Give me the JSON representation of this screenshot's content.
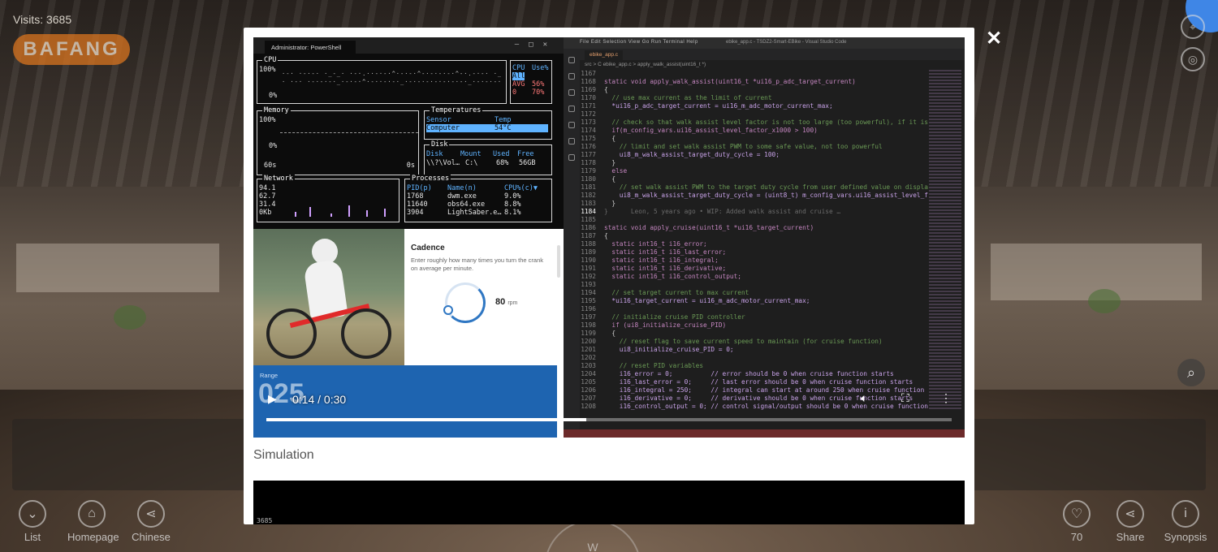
{
  "visits": {
    "label": "Visits:",
    "count": "3685"
  },
  "brand": "BAFANG",
  "bottom_nav": {
    "list": "List",
    "homepage": "Homepage",
    "chinese": "Chinese",
    "likes": "70",
    "share": "Share",
    "synopsis": "Synopsis"
  },
  "compass": "W",
  "modal": {
    "close": "✕",
    "caption": "Simulation",
    "video": {
      "current_time": "0:14",
      "separator": "/",
      "duration": "0:30",
      "progress": 0.467
    }
  },
  "terminal": {
    "tab": "Administrator: PowerShell",
    "cpu": {
      "title": "CPU",
      "y_top": "100%",
      "y_bottom": "0%",
      "hdr_cpu": "CPU",
      "hdr_use": "Use%",
      "all": "All",
      "avg": "AVG",
      "avg_val": "56%",
      "core": "0",
      "core_val": "70%"
    },
    "memory": {
      "title": "Memory",
      "y_top": "100%",
      "y_bottom": "0%",
      "x_left": "60s",
      "x_right": "0s"
    },
    "temps": {
      "title": "Temperatures",
      "h_sensor": "Sensor",
      "h_temp": "Temp",
      "sensor": "Computer",
      "temp": "54°C"
    },
    "disk": {
      "title": "Disk",
      "h_disk": "Disk",
      "h_mount": "Mount",
      "h_used": "Used",
      "h_free": "Free",
      "disk": "\\\\?\\Vol…",
      "mount": "C:\\",
      "used": "68%",
      "free": "56GB"
    },
    "network": {
      "title": "Network",
      "v1": "94.1",
      "v2": "62.7",
      "v3": "31.4",
      "v4": "0Kb"
    },
    "processes": {
      "title": "Processes",
      "h_pid": "PID(p)",
      "h_name": "Name(n)",
      "h_cpu": "CPU%(c)▼",
      "rows": [
        {
          "pid": "1768",
          "name": "dwm.exe",
          "cpu": "9.0%"
        },
        {
          "pid": "11640",
          "name": "obs64.exe",
          "cpu": "8.8%"
        },
        {
          "pid": "3904",
          "name": "LightSaber.e…",
          "cpu": "8.1%"
        }
      ]
    }
  },
  "cadence": {
    "title": "Cadence",
    "desc": "Enter roughly how many times you turn the crank on average per minute.",
    "value": "80",
    "unit": "rpm",
    "range_label": "Range",
    "range_value": "025"
  },
  "vscode": {
    "menu": "File  Edit  Selection  View  Go  Run  Terminal  Help",
    "window_title": "ebike_app.c - TSDZ2-Smart-EBike - Visual Studio Code",
    "tab": "ebike_app.c",
    "breadcrumb": "src > C ebike_app.c > apply_walk_assist(uint16_t *)",
    "lines": [
      {
        "n": "1167",
        "code": ""
      },
      {
        "n": "1168",
        "code": "static void apply_walk_assist(uint16_t *ui16_p_adc_target_current)"
      },
      {
        "n": "1169",
        "code": "{"
      },
      {
        "n": "1170",
        "code": "  // use max current as the limit of current"
      },
      {
        "n": "1171",
        "code": "  *ui16_p_adc_target_current = ui16_m_adc_motor_current_max;"
      },
      {
        "n": "1172",
        "code": ""
      },
      {
        "n": "1173",
        "code": "  // check so that walk assist level factor is not too large (too powerful), if it is"
      },
      {
        "n": "1174",
        "code": "  if(m_config_vars.ui16_assist_level_factor_x1000 > 100)"
      },
      {
        "n": "1175",
        "code": "  {"
      },
      {
        "n": "1176",
        "code": "    // limit and set walk assist PWM to some safe value, not too powerful"
      },
      {
        "n": "1177",
        "code": "    ui8_m_walk_assist_target_duty_cycle = 100;"
      },
      {
        "n": "1178",
        "code": "  }"
      },
      {
        "n": "1179",
        "code": "  else"
      },
      {
        "n": "1180",
        "code": "  {"
      },
      {
        "n": "1181",
        "code": "    // set walk assist PWM to the target duty cycle from user defined value on displa"
      },
      {
        "n": "1182",
        "code": "    ui8_m_walk_assist_target_duty_cycle = (uint8_t) m_config_vars.ui16_assist_level_f"
      },
      {
        "n": "1183",
        "code": "  }"
      },
      {
        "n": "1184",
        "code": "}      Leon, 5 years ago • WIP: Added walk assist and cruise …"
      },
      {
        "n": "1185",
        "code": ""
      },
      {
        "n": "1186",
        "code": "static void apply_cruise(uint16_t *ui16_target_current)"
      },
      {
        "n": "1187",
        "code": "{"
      },
      {
        "n": "1188",
        "code": "  static int16_t i16_error;"
      },
      {
        "n": "1189",
        "code": "  static int16_t i16_last_error;"
      },
      {
        "n": "1190",
        "code": "  static int16_t i16_integral;"
      },
      {
        "n": "1191",
        "code": "  static int16_t i16_derivative;"
      },
      {
        "n": "1192",
        "code": "  static int16_t i16_control_output;"
      },
      {
        "n": "1193",
        "code": ""
      },
      {
        "n": "1194",
        "code": "  // set target current to max current"
      },
      {
        "n": "1195",
        "code": "  *ui16_target_current = ui16_m_adc_motor_current_max;"
      },
      {
        "n": "1196",
        "code": ""
      },
      {
        "n": "1197",
        "code": "  // initialize cruise PID controller"
      },
      {
        "n": "1198",
        "code": "  if (ui8_initialize_cruise_PID)"
      },
      {
        "n": "1199",
        "code": "  {"
      },
      {
        "n": "1200",
        "code": "    // reset flag to save current speed to maintain (for cruise function)"
      },
      {
        "n": "1201",
        "code": "    ui8_initialize_cruise_PID = 0;"
      },
      {
        "n": "1202",
        "code": ""
      },
      {
        "n": "1203",
        "code": "    // reset PID variables"
      },
      {
        "n": "1204",
        "code": "    i16_error = 0;          // error should be 0 when cruise function starts"
      },
      {
        "n": "1205",
        "code": "    i16_last_error = 0;     // last error should be 0 when cruise function starts"
      },
      {
        "n": "1206",
        "code": "    i16_integral = 250;     // integral can start at around 250 when cruise function"
      },
      {
        "n": "1207",
        "code": "    i16_derivative = 0;     // derivative should be 0 when cruise function starts"
      },
      {
        "n": "1208",
        "code": "    i16_control_output = 0; // control signal/output should be 0 when cruise function"
      }
    ],
    "current_line": "1184"
  },
  "video2": {
    "label": "3685"
  }
}
